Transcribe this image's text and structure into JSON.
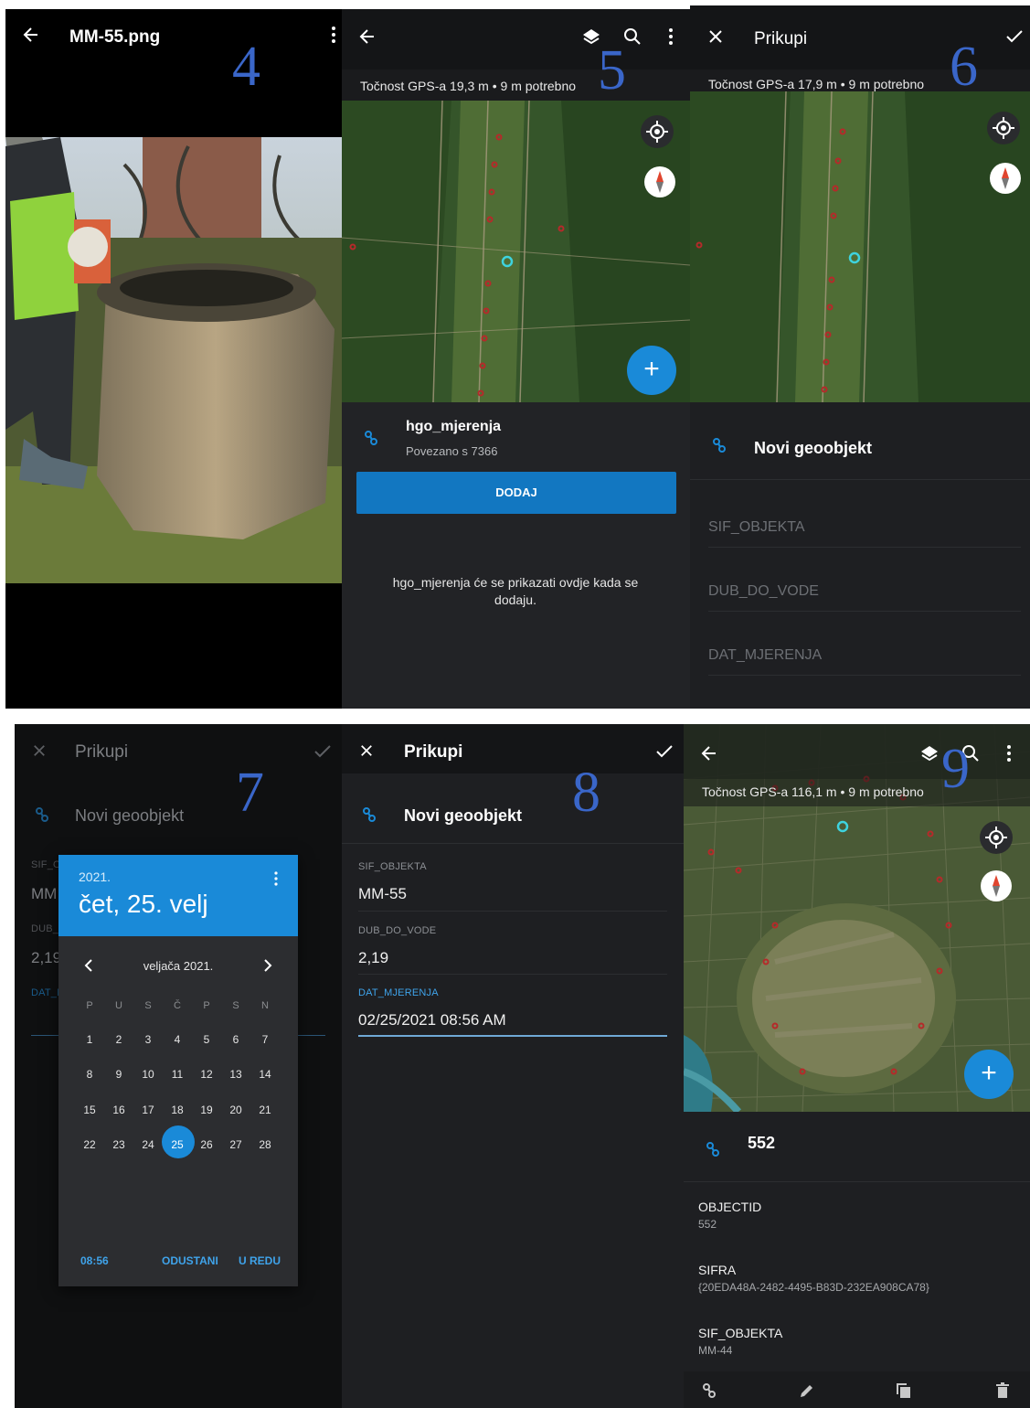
{
  "colors": {
    "accent": "#1a8ad8",
    "step_number": "#3a66c9",
    "background": "#1e1f22"
  },
  "panel4": {
    "step": "4",
    "title": "MM-55.png",
    "back_icon": "arrow-left-icon",
    "menu_icon": "more-vertical-icon"
  },
  "panel5": {
    "step": "5",
    "gps_status": "Točnost GPS-a 19,3 m  • 9 m potrebno",
    "related_table": {
      "name": "hgo_mjerenja",
      "subtitle": "Povezano s 7366"
    },
    "add_button": "DODAJ",
    "empty_message": "hgo_mjerenja će se prikazati ovdje kada se dodaju."
  },
  "panel6": {
    "step": "6",
    "title": "Prikupi",
    "gps_status": "Točnost GPS-a 17,9 m  • 9 m potrebno",
    "feature_title": "Novi geoobjekt",
    "fields": [
      "SIF_OBJEKTA",
      "DUB_DO_VODE",
      "DAT_MJERENJA"
    ]
  },
  "panel7": {
    "step": "7",
    "title": "Prikupi",
    "feature_title": "Novi geoobjekt",
    "bg_labels": [
      "SIF_O",
      "DUB_D",
      "DAT_M"
    ],
    "bg_values": [
      "MM",
      "2,19"
    ],
    "picker": {
      "year": "2021.",
      "date": "čet, 25. velj",
      "month": "veljača 2021.",
      "weekdays": [
        "P",
        "U",
        "S",
        "Č",
        "P",
        "S",
        "N"
      ],
      "weeks": [
        [
          "1",
          "2",
          "3",
          "4",
          "5",
          "6",
          "7"
        ],
        [
          "8",
          "9",
          "10",
          "11",
          "12",
          "13",
          "14"
        ],
        [
          "15",
          "16",
          "17",
          "18",
          "19",
          "20",
          "21"
        ],
        [
          "22",
          "23",
          "24",
          "25",
          "26",
          "27",
          "28"
        ]
      ],
      "selected_day": "25",
      "time": "08:56",
      "cancel": "ODUSTANI",
      "ok": "U REDU"
    }
  },
  "panel8": {
    "step": "8",
    "title": "Prikupi",
    "feature_title": "Novi geoobjekt",
    "fields": [
      {
        "label": "SIF_OBJEKTA",
        "value": "MM-55"
      },
      {
        "label": "DUB_DO_VODE",
        "value": "2,19"
      },
      {
        "label": "DAT_MJERENJA",
        "value": "02/25/2021 08:56 AM"
      }
    ]
  },
  "panel9": {
    "step": "9",
    "gps_status": "Točnost GPS-a 116,1 m  • 9 m potrebno",
    "feature_title": "552",
    "attributes": [
      {
        "label": "OBJECTID",
        "value": "552"
      },
      {
        "label": "SIFRA",
        "value": "{20EDA48A-2482-4495-B83D-232EA908CA78}"
      },
      {
        "label": "SIF_OBJEKTA",
        "value": "MM-44"
      }
    ]
  }
}
